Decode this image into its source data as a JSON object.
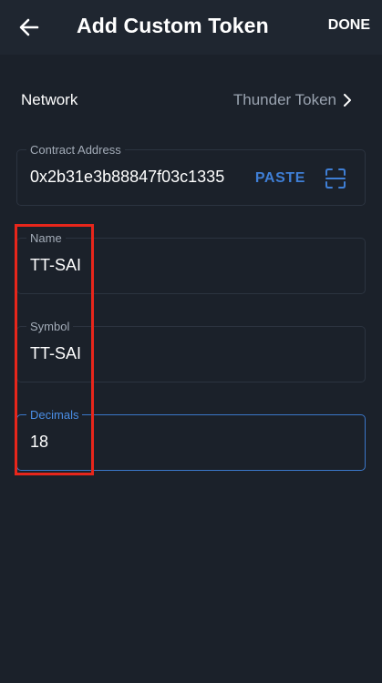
{
  "header": {
    "title": "Add Custom Token",
    "done_label": "DONE",
    "back_icon": "arrow-left-icon"
  },
  "network": {
    "label": "Network",
    "value": "Thunder Token",
    "chevron_icon": "chevron-right-icon"
  },
  "fields": {
    "contract_address": {
      "label": "Contract Address",
      "value": "0x2b31e3b88847f03c1335",
      "paste_label": "PASTE",
      "scan_icon": "scan-icon"
    },
    "name": {
      "label": "Name",
      "value": "TT-SAI"
    },
    "symbol": {
      "label": "Symbol",
      "value": "TT-SAI"
    },
    "decimals": {
      "label": "Decimals",
      "value": "18"
    }
  },
  "colors": {
    "background": "#1b212a",
    "app_bar": "#1f2630",
    "accent": "#3f7fd6",
    "highlight": "#e8261b"
  }
}
